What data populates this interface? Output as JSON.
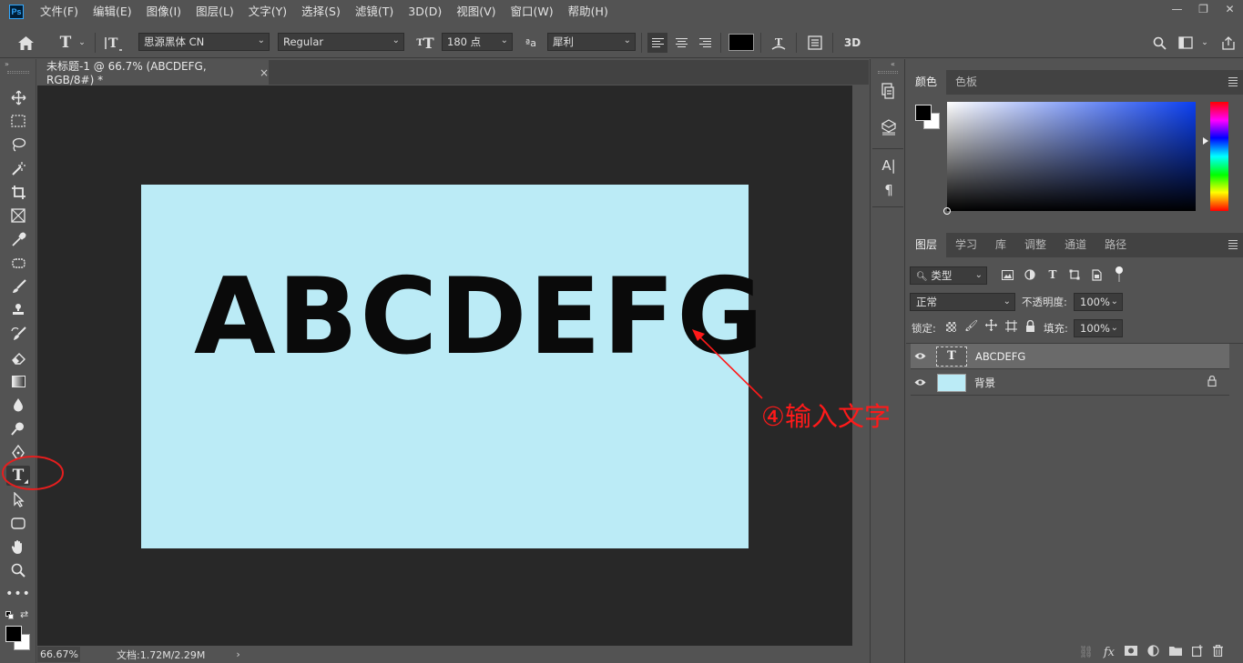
{
  "app": {
    "logo_text": "Ps",
    "menu": [
      "文件(F)",
      "编辑(E)",
      "图像(I)",
      "图层(L)",
      "文字(Y)",
      "选择(S)",
      "滤镜(T)",
      "3D(D)",
      "视图(V)",
      "窗口(W)",
      "帮助(H)"
    ],
    "window_controls": {
      "minimize": "—",
      "restore": "❐",
      "close": "✕"
    }
  },
  "options_bar": {
    "font_family": "思源黑体 CN",
    "font_style": "Regular",
    "font_size": "180 点",
    "anti_alias_glyph": "ªa",
    "anti_alias": "犀利",
    "text_color": "#000000",
    "three_d_label": "3D"
  },
  "document": {
    "tab_title": "未标题-1 @ 66.7% (ABCDEFG, RGB/8#) *",
    "tab_close": "×",
    "canvas_bg": "#bbebf6",
    "canvas_text": "ABCDEFG"
  },
  "annotation": {
    "text": "④输入文字",
    "color": "#ff1a1a"
  },
  "status_bar": {
    "zoom": "66.67%",
    "doc_info": "文档:1.72M/2.29M",
    "arrow": "›"
  },
  "color_panel": {
    "tabs": [
      "颜色",
      "色板"
    ],
    "active_tab": 0,
    "foreground": "#000000",
    "background": "#ffffff",
    "hue_color": "#0b3ff0"
  },
  "layers_panel": {
    "tabs": [
      "图层",
      "学习",
      "库",
      "调整",
      "通道",
      "路径"
    ],
    "active_tab": 0,
    "filter_kind": "类型",
    "blend_mode": "正常",
    "opacity_label": "不透明度:",
    "opacity": "100%",
    "lock_label": "锁定:",
    "fill_label": "填充:",
    "fill": "100%",
    "layers": [
      {
        "name": "ABCDEFG",
        "type": "text",
        "thumb_glyph": "T",
        "selected": true
      },
      {
        "name": "背景",
        "type": "background",
        "locked": true
      }
    ]
  }
}
